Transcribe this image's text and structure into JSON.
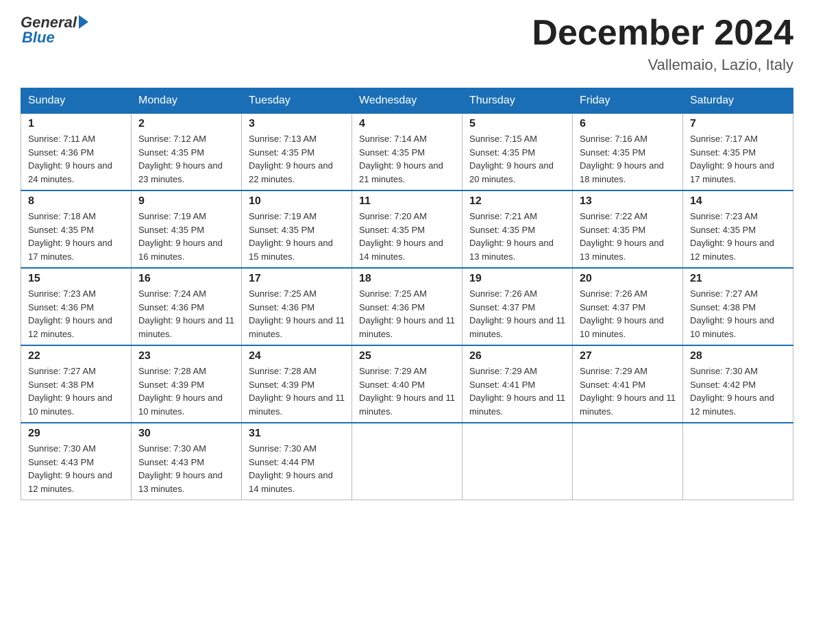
{
  "logo": {
    "general": "General",
    "blue": "Blue"
  },
  "header": {
    "month": "December 2024",
    "location": "Vallemaio, Lazio, Italy"
  },
  "weekdays": [
    "Sunday",
    "Monday",
    "Tuesday",
    "Wednesday",
    "Thursday",
    "Friday",
    "Saturday"
  ],
  "weeks": [
    [
      {
        "day": "1",
        "sunrise": "7:11 AM",
        "sunset": "4:36 PM",
        "daylight": "9 hours and 24 minutes."
      },
      {
        "day": "2",
        "sunrise": "7:12 AM",
        "sunset": "4:35 PM",
        "daylight": "9 hours and 23 minutes."
      },
      {
        "day": "3",
        "sunrise": "7:13 AM",
        "sunset": "4:35 PM",
        "daylight": "9 hours and 22 minutes."
      },
      {
        "day": "4",
        "sunrise": "7:14 AM",
        "sunset": "4:35 PM",
        "daylight": "9 hours and 21 minutes."
      },
      {
        "day": "5",
        "sunrise": "7:15 AM",
        "sunset": "4:35 PM",
        "daylight": "9 hours and 20 minutes."
      },
      {
        "day": "6",
        "sunrise": "7:16 AM",
        "sunset": "4:35 PM",
        "daylight": "9 hours and 18 minutes."
      },
      {
        "day": "7",
        "sunrise": "7:17 AM",
        "sunset": "4:35 PM",
        "daylight": "9 hours and 17 minutes."
      }
    ],
    [
      {
        "day": "8",
        "sunrise": "7:18 AM",
        "sunset": "4:35 PM",
        "daylight": "9 hours and 17 minutes."
      },
      {
        "day": "9",
        "sunrise": "7:19 AM",
        "sunset": "4:35 PM",
        "daylight": "9 hours and 16 minutes."
      },
      {
        "day": "10",
        "sunrise": "7:19 AM",
        "sunset": "4:35 PM",
        "daylight": "9 hours and 15 minutes."
      },
      {
        "day": "11",
        "sunrise": "7:20 AM",
        "sunset": "4:35 PM",
        "daylight": "9 hours and 14 minutes."
      },
      {
        "day": "12",
        "sunrise": "7:21 AM",
        "sunset": "4:35 PM",
        "daylight": "9 hours and 13 minutes."
      },
      {
        "day": "13",
        "sunrise": "7:22 AM",
        "sunset": "4:35 PM",
        "daylight": "9 hours and 13 minutes."
      },
      {
        "day": "14",
        "sunrise": "7:23 AM",
        "sunset": "4:35 PM",
        "daylight": "9 hours and 12 minutes."
      }
    ],
    [
      {
        "day": "15",
        "sunrise": "7:23 AM",
        "sunset": "4:36 PM",
        "daylight": "9 hours and 12 minutes."
      },
      {
        "day": "16",
        "sunrise": "7:24 AM",
        "sunset": "4:36 PM",
        "daylight": "9 hours and 11 minutes."
      },
      {
        "day": "17",
        "sunrise": "7:25 AM",
        "sunset": "4:36 PM",
        "daylight": "9 hours and 11 minutes."
      },
      {
        "day": "18",
        "sunrise": "7:25 AM",
        "sunset": "4:36 PM",
        "daylight": "9 hours and 11 minutes."
      },
      {
        "day": "19",
        "sunrise": "7:26 AM",
        "sunset": "4:37 PM",
        "daylight": "9 hours and 11 minutes."
      },
      {
        "day": "20",
        "sunrise": "7:26 AM",
        "sunset": "4:37 PM",
        "daylight": "9 hours and 10 minutes."
      },
      {
        "day": "21",
        "sunrise": "7:27 AM",
        "sunset": "4:38 PM",
        "daylight": "9 hours and 10 minutes."
      }
    ],
    [
      {
        "day": "22",
        "sunrise": "7:27 AM",
        "sunset": "4:38 PM",
        "daylight": "9 hours and 10 minutes."
      },
      {
        "day": "23",
        "sunrise": "7:28 AM",
        "sunset": "4:39 PM",
        "daylight": "9 hours and 10 minutes."
      },
      {
        "day": "24",
        "sunrise": "7:28 AM",
        "sunset": "4:39 PM",
        "daylight": "9 hours and 11 minutes."
      },
      {
        "day": "25",
        "sunrise": "7:29 AM",
        "sunset": "4:40 PM",
        "daylight": "9 hours and 11 minutes."
      },
      {
        "day": "26",
        "sunrise": "7:29 AM",
        "sunset": "4:41 PM",
        "daylight": "9 hours and 11 minutes."
      },
      {
        "day": "27",
        "sunrise": "7:29 AM",
        "sunset": "4:41 PM",
        "daylight": "9 hours and 11 minutes."
      },
      {
        "day": "28",
        "sunrise": "7:30 AM",
        "sunset": "4:42 PM",
        "daylight": "9 hours and 12 minutes."
      }
    ],
    [
      {
        "day": "29",
        "sunrise": "7:30 AM",
        "sunset": "4:43 PM",
        "daylight": "9 hours and 12 minutes."
      },
      {
        "day": "30",
        "sunrise": "7:30 AM",
        "sunset": "4:43 PM",
        "daylight": "9 hours and 13 minutes."
      },
      {
        "day": "31",
        "sunrise": "7:30 AM",
        "sunset": "4:44 PM",
        "daylight": "9 hours and 14 minutes."
      },
      null,
      null,
      null,
      null
    ]
  ]
}
